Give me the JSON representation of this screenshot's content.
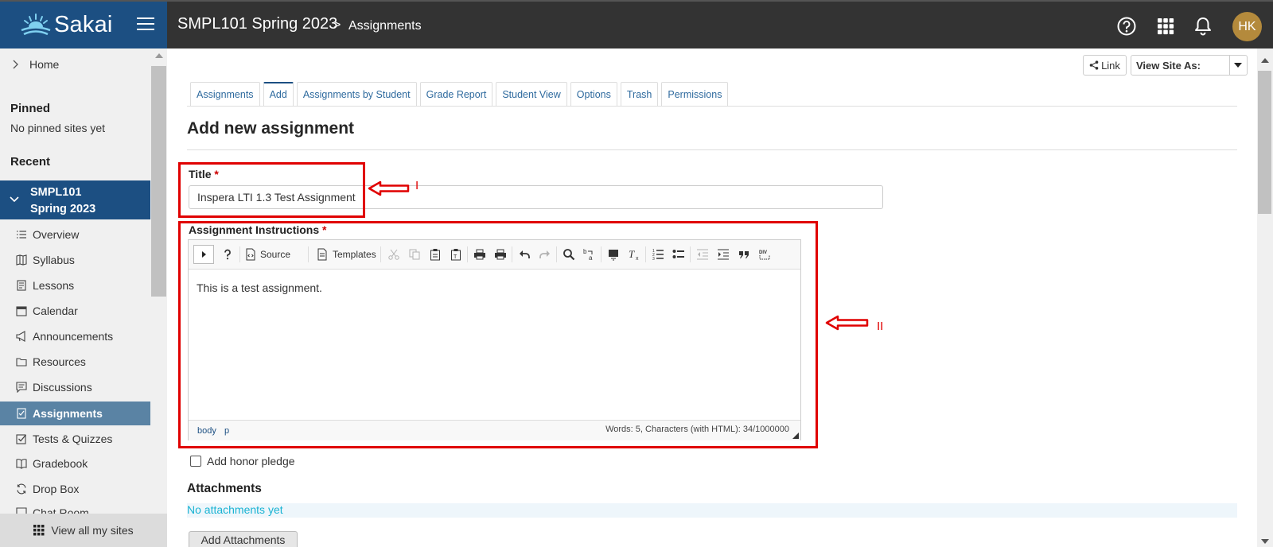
{
  "header": {
    "logo_text": "Sakai",
    "site_title": "SMPL101 Spring 2023",
    "breadcrumb_sep": ">",
    "breadcrumb_page": "Assignments",
    "avatar_initials": "HK",
    "icons": [
      "menu-icon",
      "help-icon",
      "apps-grid-icon",
      "bell-icon"
    ],
    "colors": {
      "topbar": "#333333",
      "logo_bg": "#1c4f82",
      "avatar": "#b48a3c"
    }
  },
  "sidebar": {
    "home": "Home",
    "pinned_heading": "Pinned",
    "pinned_empty": "No pinned sites yet",
    "recent_heading": "Recent",
    "active_site_line1": "SMPL101",
    "active_site_line2": "Spring 2023",
    "items": [
      {
        "label": "Overview",
        "icon": "list-icon"
      },
      {
        "label": "Syllabus",
        "icon": "map-icon"
      },
      {
        "label": "Lessons",
        "icon": "document-icon"
      },
      {
        "label": "Calendar",
        "icon": "calendar-icon"
      },
      {
        "label": "Announcements",
        "icon": "megaphone-icon"
      },
      {
        "label": "Resources",
        "icon": "folder-icon"
      },
      {
        "label": "Discussions",
        "icon": "chat-icon"
      },
      {
        "label": "Assignments",
        "icon": "assignment-icon",
        "active": true
      },
      {
        "label": "Tests & Quizzes",
        "icon": "checkbox-icon"
      },
      {
        "label": "Gradebook",
        "icon": "book-icon"
      },
      {
        "label": "Drop Box",
        "icon": "sync-icon"
      },
      {
        "label": "Chat Room",
        "icon": "chat-room-icon"
      }
    ],
    "view_all": "View all my sites"
  },
  "toolbar": {
    "link_label": "Link",
    "view_site_as": "View Site As:"
  },
  "tabs": [
    "Assignments",
    "Add",
    "Assignments by Student",
    "Grade Report",
    "Student View",
    "Options",
    "Trash",
    "Permissions"
  ],
  "active_tab": "Add",
  "form": {
    "heading": "Add new assignment",
    "title_label": "Title",
    "required_mark": "*",
    "title_value": "Inspera LTI 1.3 Test Assignment",
    "instructions_label": "Assignment Instructions",
    "editor": {
      "source_label": "Source",
      "templates_label": "Templates",
      "body_text": "This is a test assignment.",
      "path_body": "body",
      "path_p": "p",
      "word_count": "Words: 5, Characters (with HTML): 34/1000000"
    },
    "honor_pledge": "Add honor pledge",
    "honor_checked": false,
    "attachments_heading": "Attachments",
    "no_attachments": "No attachments yet",
    "add_attachments": "Add Attachments"
  },
  "annotations": {
    "label_one": "I",
    "label_two": "II",
    "color": "#e00000"
  }
}
